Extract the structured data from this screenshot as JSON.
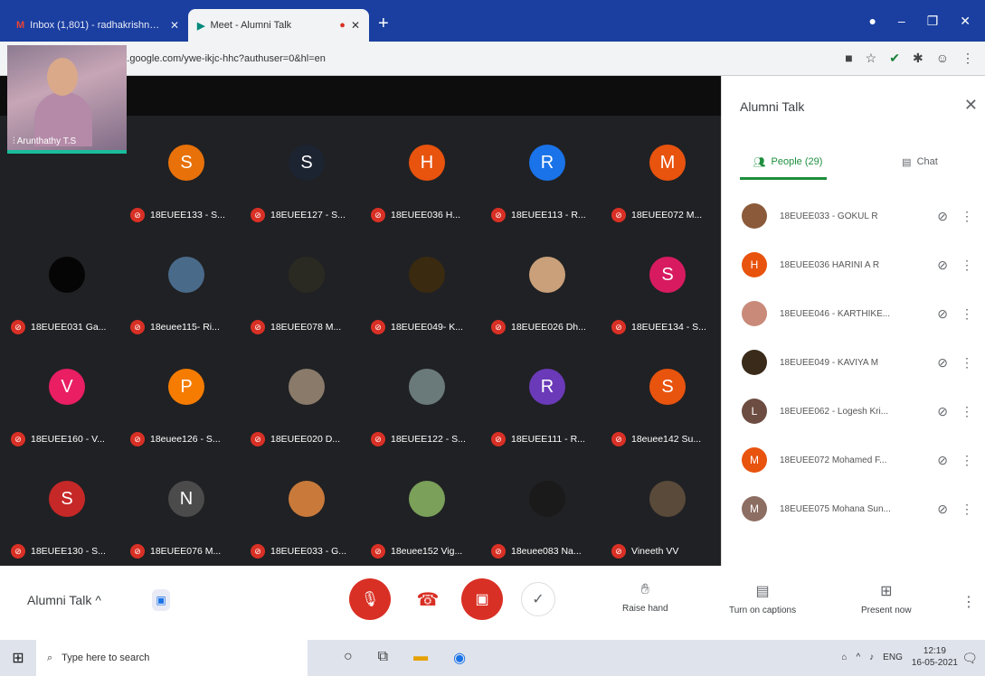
{
  "browser": {
    "tabs": [
      {
        "icon": "gmail-icon",
        "title": "Inbox (1,801) - radhakrishnangk",
        "active": false
      },
      {
        "icon": "meet-icon",
        "title": "Meet - Alumni Talk",
        "active": true
      }
    ],
    "new_tab": "+",
    "url": "meet.google.com/ywe-ikjc-hhc?authuser=0&hl=en"
  },
  "meeting": {
    "title": "Alumni Talk",
    "presenter_name": "Arunthathy T.S",
    "tiles": [
      {
        "initial": "S",
        "color": "#e8710a",
        "name": "18EUEE133 - S..."
      },
      {
        "initial": "S",
        "color": "#1c2331",
        "name": "18EUEE127 - S..."
      },
      {
        "initial": "H",
        "color": "#e8530e",
        "name": "18EUEE036 H..."
      },
      {
        "initial": "R",
        "color": "#1a73e8",
        "name": "18EUEE113 - R..."
      },
      {
        "initial": "M",
        "color": "#e8530e",
        "name": "18EUEE072 M..."
      },
      {
        "initial": "",
        "color": "#050505",
        "name": "18EUEE031 Ga..."
      },
      {
        "initial": "",
        "color": "#4a6a8a",
        "name": "18euee115- Ri..."
      },
      {
        "initial": "",
        "color": "#2a2a22",
        "name": "18EUEE078 M..."
      },
      {
        "initial": "",
        "color": "#3a2a10",
        "name": "18EUEE049- K..."
      },
      {
        "initial": "",
        "color": "#c9a07a",
        "name": "18EUEE026 Dh..."
      },
      {
        "initial": "S",
        "color": "#d81b60",
        "name": "18EUEE134 - S..."
      },
      {
        "initial": "V",
        "color": "#e91e63",
        "name": "18EUEE160 - V..."
      },
      {
        "initial": "P",
        "color": "#f57c00",
        "name": "18euee126 - S..."
      },
      {
        "initial": "",
        "color": "#8a7a6a",
        "name": "18EUEE020 D..."
      },
      {
        "initial": "",
        "color": "#6a7a7a",
        "name": "18EUEE122 - S..."
      },
      {
        "initial": "R",
        "color": "#6a3ab8",
        "name": "18EUEE111 - R..."
      },
      {
        "initial": "S",
        "color": "#e8530e",
        "name": "18euee142 Su..."
      },
      {
        "initial": "S",
        "color": "#c62828",
        "name": "18EUEE130 - S..."
      },
      {
        "initial": "N",
        "color": "#4b4b4b",
        "name": "18EUEE076 M..."
      },
      {
        "initial": "",
        "color": "#c97a3a",
        "name": "18EUEE033 - G..."
      },
      {
        "initial": "",
        "color": "#7aa05a",
        "name": "18euee152 Vig..."
      },
      {
        "initial": "",
        "color": "#1a1a1a",
        "name": "18euee083 Na..."
      },
      {
        "initial": "",
        "color": "#5a4a3a",
        "name": "Vineeth VV"
      }
    ]
  },
  "sidebar": {
    "title": "Alumni Talk",
    "tab_people": "People (29)",
    "tab_chat": "Chat",
    "people": [
      {
        "initial": "",
        "color": "#8a5a3a",
        "name": "18EUEE033 - GOKUL R"
      },
      {
        "initial": "H",
        "color": "#e8530e",
        "name": "18EUEE036 HARINI A R"
      },
      {
        "initial": "",
        "color": "#c98a7a",
        "name": "18EUEE046 - KARTHIKE..."
      },
      {
        "initial": "",
        "color": "#3a2a1a",
        "name": "18EUEE049 - KAVIYA M"
      },
      {
        "initial": "L",
        "color": "#6d4c41",
        "name": "18EUEE062 - Logesh Kri..."
      },
      {
        "initial": "M",
        "color": "#e8530e",
        "name": "18EUEE072 Mohamed F..."
      },
      {
        "initial": "M",
        "color": "#8d6e63",
        "name": "18EUEE075 Mohana Sun..."
      }
    ]
  },
  "controls": {
    "raise_hand": "Raise hand",
    "captions": "Turn on captions",
    "present": "Present now"
  },
  "taskbar": {
    "search_placeholder": "Type here to search",
    "lang": "ENG",
    "time": "12:19",
    "date": "16-05-2021"
  }
}
